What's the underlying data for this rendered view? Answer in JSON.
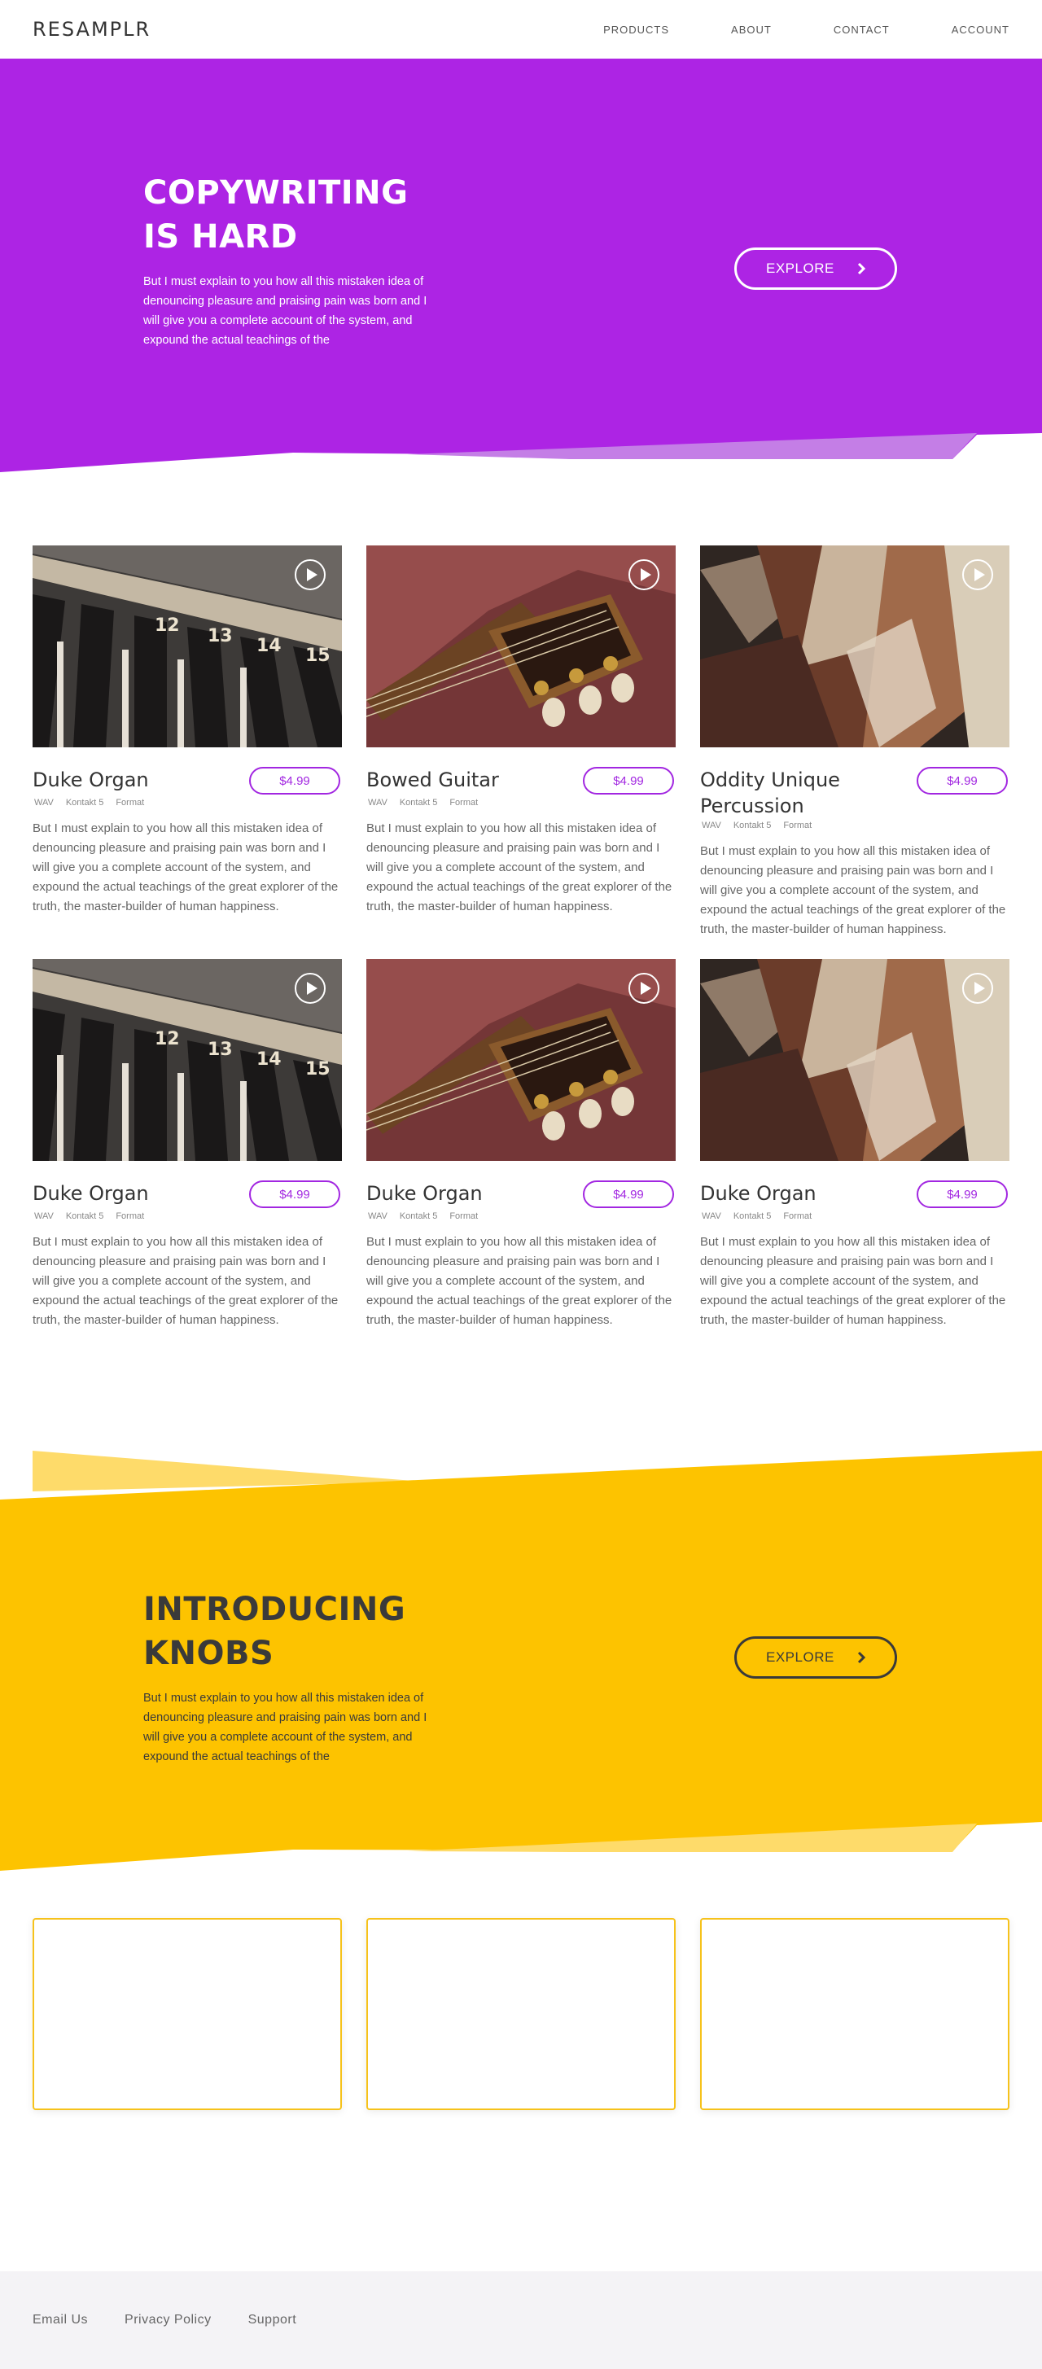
{
  "brand": "RESAMPLR",
  "nav": {
    "links": [
      "PRODUCTS",
      "ABOUT",
      "CONTACT",
      "ACCOUNT"
    ]
  },
  "colors": {
    "purple": "#ad24e4",
    "purple_light": "#c47ee6",
    "yellow": "#fdc300",
    "yellow_light": "#fedb6a"
  },
  "hero": {
    "title": "COPYWRITING IS HARD",
    "text": "But I must explain to you how all this mistaken idea of denouncing pleasure and praising pain was born and I will give you a complete account of the system, and expound the actual teachings of the",
    "button": "EXPLORE"
  },
  "products": [
    {
      "title": "Duke Organ",
      "price": "$4.99",
      "tags": [
        "WAV",
        "Kontakt 5",
        "Format"
      ],
      "desc": "But I must explain to you how all this mistaken idea of denouncing pleasure and praising pain was born and I will give you a complete account of the system, and expound the actual teachings of the great explorer of the truth, the master-builder of human happiness.",
      "image": "piano-keys"
    },
    {
      "title": "Bowed Guitar",
      "price": "$4.99",
      "tags": [
        "WAV",
        "Kontakt 5",
        "Format"
      ],
      "desc": "But I must explain to you how all this mistaken idea of denouncing pleasure and praising pain was born and I will give you a complete account of the system, and expound the actual teachings of the great explorer of the truth, the master-builder of human happiness.",
      "image": "guitar-head"
    },
    {
      "title": "Oddity Unique Percussion",
      "price": "$4.99",
      "tags": [
        "WAV",
        "Kontakt 5",
        "Format"
      ],
      "desc": "But I must explain to you how all this mistaken idea of denouncing pleasure and praising pain was born and I will give you a complete account of the system, and expound the actual teachings of the great explorer of the truth, the master-builder of human happiness.",
      "image": "metal-percussion"
    },
    {
      "title": "Duke Organ",
      "price": "$4.99",
      "tags": [
        "WAV",
        "Kontakt 5",
        "Format"
      ],
      "desc": "But I must explain to you how all this mistaken idea of denouncing pleasure and praising pain was born and I will give you a complete account of the system, and expound the actual teachings of the great explorer of the truth, the master-builder of human happiness.",
      "image": "piano-keys"
    },
    {
      "title": "Duke Organ",
      "price": "$4.99",
      "tags": [
        "WAV",
        "Kontakt 5",
        "Format"
      ],
      "desc": "But I must explain to you how all this mistaken idea of denouncing pleasure and praising pain was born and I will give you a complete account of the system, and expound the actual teachings of the great explorer of the truth, the master-builder of human happiness.",
      "image": "guitar-head"
    },
    {
      "title": "Duke Organ",
      "price": "$4.99",
      "tags": [
        "WAV",
        "Kontakt 5",
        "Format"
      ],
      "desc": "But I must explain to you how all this mistaken idea of denouncing pleasure and praising pain was born and I will give you a complete account of the system, and expound the actual teachings of the great explorer of the truth, the master-builder of human happiness.",
      "image": "metal-percussion"
    }
  ],
  "knobs": {
    "title": "INTRODUCING KNOBS",
    "text": "But I must explain to you how all this mistaken idea of denouncing pleasure and praising pain was born and I will give you a complete account of the system, and expound the actual teachings of the",
    "button": "EXPLORE"
  },
  "footer": {
    "links": [
      "Email Us",
      "Privacy Policy",
      "Support"
    ]
  }
}
